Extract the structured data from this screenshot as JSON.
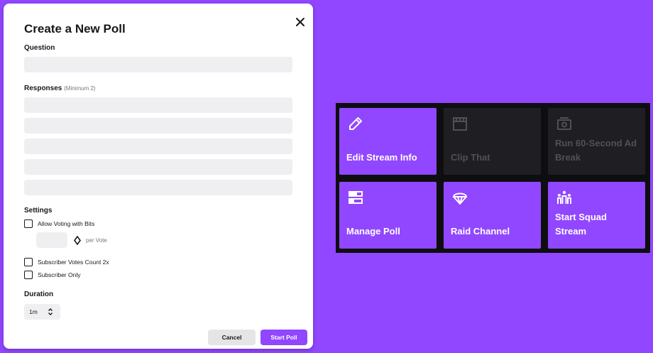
{
  "modal": {
    "title": "Create a New Poll",
    "question_label": "Question",
    "responses_label": "Responses",
    "responses_hint": "(Minimum 2)",
    "responses": [
      "",
      "",
      "",
      "",
      ""
    ],
    "settings_label": "Settings",
    "allow_bits_label": "Allow Voting with Bits",
    "bits_value": "",
    "per_vote_label": "per Vote",
    "subscriber_votes_label": "Subscriber Votes Count 2x",
    "subscriber_only_label": "Subscriber Only",
    "duration_label": "Duration",
    "duration_value": "1m",
    "cancel_label": "Cancel",
    "start_label": "Start Poll"
  },
  "quick_actions": [
    {
      "label": "Edit Stream Info",
      "icon": "pencil-icon",
      "enabled": true
    },
    {
      "label": "Clip That",
      "icon": "clapperboard-icon",
      "enabled": false
    },
    {
      "label": "Run 60-Second Ad Break",
      "icon": "ad-icon",
      "enabled": false
    },
    {
      "label": "Manage Poll",
      "icon": "poll-icon",
      "enabled": true
    },
    {
      "label": "Raid Channel",
      "icon": "raid-icon",
      "enabled": true
    },
    {
      "label": "Start Squad Stream",
      "icon": "squad-icon",
      "enabled": true
    }
  ],
  "colors": {
    "background": "#9146ff",
    "tile_active": "#9147ff",
    "tile_disabled": "#1f1f23",
    "panel": "#0e0e10"
  }
}
